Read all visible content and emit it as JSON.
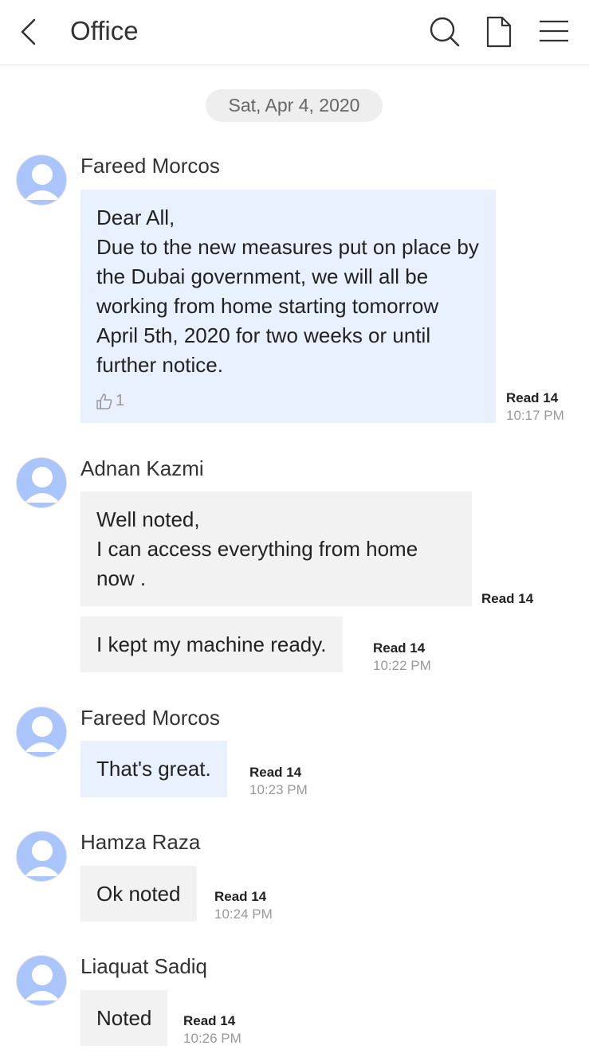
{
  "header": {
    "title": "Office",
    "icons": [
      "chevron-left-icon",
      "search-icon",
      "file-icon",
      "menu-icon"
    ]
  },
  "date_separator": "Sat, Apr 4, 2020",
  "messages": [
    {
      "sender": "Fareed Morcos",
      "text": "Dear All,\nDue to the new measures put on place by the Dubai government, we will all be working from home starting tomorrow April 5th, 2020 for two weeks or until further notice.",
      "likes": "1",
      "read": "Read 14",
      "time": "10:17 PM"
    },
    {
      "sender": "Adnan Kazmi",
      "text": "Well noted,\nI can access everything from home now .",
      "read": "Read 14"
    },
    {
      "text": "I kept my machine ready.",
      "read": "Read 14",
      "time": "10:22 PM"
    },
    {
      "sender": "Fareed Morcos",
      "text": "That's great.",
      "read": "Read 14",
      "time": "10:23 PM"
    },
    {
      "sender": "Hamza Raza",
      "text": "Ok noted",
      "read": "Read 14",
      "time": "10:24 PM"
    },
    {
      "sender": "Liaquat Sadiq",
      "text": "Noted",
      "read": "Read 14",
      "time": "10:26 PM"
    }
  ],
  "colors": {
    "own_bubble": "#e8f1fd",
    "other_bubble": "#f2f2f2",
    "avatar": "#a9c5fb",
    "muted_text": "#999999"
  }
}
